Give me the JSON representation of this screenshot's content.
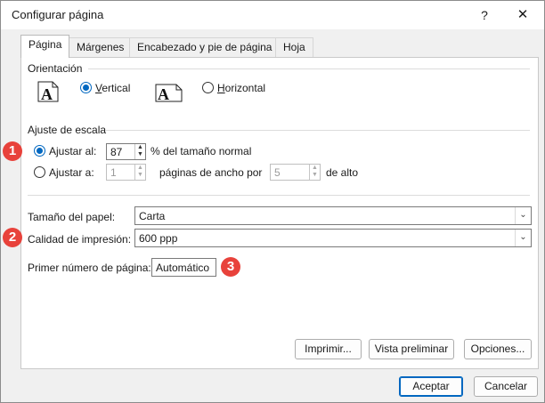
{
  "window": {
    "title": "Configurar página",
    "help_glyph": "?",
    "close_glyph": "✕"
  },
  "tabs": [
    {
      "label": "Página",
      "active": true
    },
    {
      "label": "Márgenes",
      "active": false
    },
    {
      "label": "Encabezado y pie de página",
      "active": false
    },
    {
      "label": "Hoja",
      "active": false
    }
  ],
  "orientation": {
    "heading": "Orientación",
    "page_icon_letter": "A",
    "vertical_label": "Vertical",
    "horizontal_label": "Horizontal",
    "selected": "Vertical"
  },
  "scaling": {
    "heading": "Ajuste de escala",
    "adjust_to_label": "Ajustar al:",
    "adjust_to_value": "87",
    "adjust_to_suffix": "% del tamaño normal",
    "fit_to_label": "Ajustar a:",
    "fit_wide_value": "1",
    "fit_wide_suffix": "páginas de ancho por",
    "fit_tall_value": "5",
    "fit_tall_suffix": "de alto",
    "selected": "Ajustar al:"
  },
  "paper_size": {
    "label": "Tamaño del papel:",
    "value": "Carta"
  },
  "print_quality": {
    "label": "Calidad de impresión:",
    "value": "600 ppp"
  },
  "first_page_number": {
    "label": "Primer número de página:",
    "value": "Automático"
  },
  "buttons": {
    "print": "Imprimir...",
    "preview": "Vista preliminar",
    "options": "Opciones...",
    "ok": "Aceptar",
    "cancel": "Cancelar"
  },
  "badges": [
    "1",
    "2",
    "3"
  ],
  "colors": {
    "accent": "#0067c0",
    "badge": "#e8423b"
  }
}
